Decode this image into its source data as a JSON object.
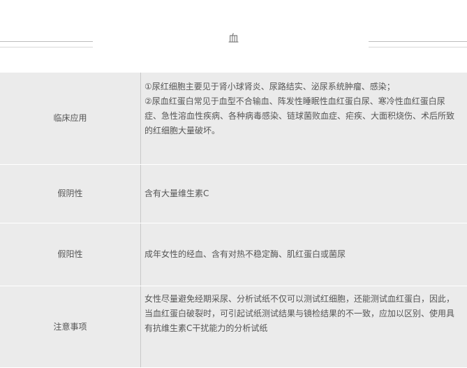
{
  "header": {
    "title": "血"
  },
  "rows": [
    {
      "label": "临床应用",
      "lines": [
        "①尿红细胞主要见于肾小球肾炎、尿路结实、泌尿系统肿瘤、感染；",
        "②尿血红蛋白常见于血型不合输血、阵发性睡眠性血红蛋白尿、寒冷性血红蛋白尿症、急性溶血性疾病、各种病毒感染、链球菌败血症、疟疾、大面积烧伤、术后所致的红细胞大量破坏。"
      ]
    },
    {
      "label": "假阴性",
      "lines": [
        "含有大量维生素C"
      ]
    },
    {
      "label": "假阳性",
      "lines": [
        "成年女性的经血、含有对热不稳定酶、肌红蛋白或菌尿"
      ]
    },
    {
      "label": "注意事项",
      "lines": [
        "女性尽量避免经期采尿、分析试纸不仅可以测试红细胞，还能测试血红蛋白，因此，当血红蛋白破裂时，可引起试纸测试结果与镜检结果的不一致，应加以区别、使用具有抗维生素C干扰能力的分析试纸"
      ]
    }
  ]
}
